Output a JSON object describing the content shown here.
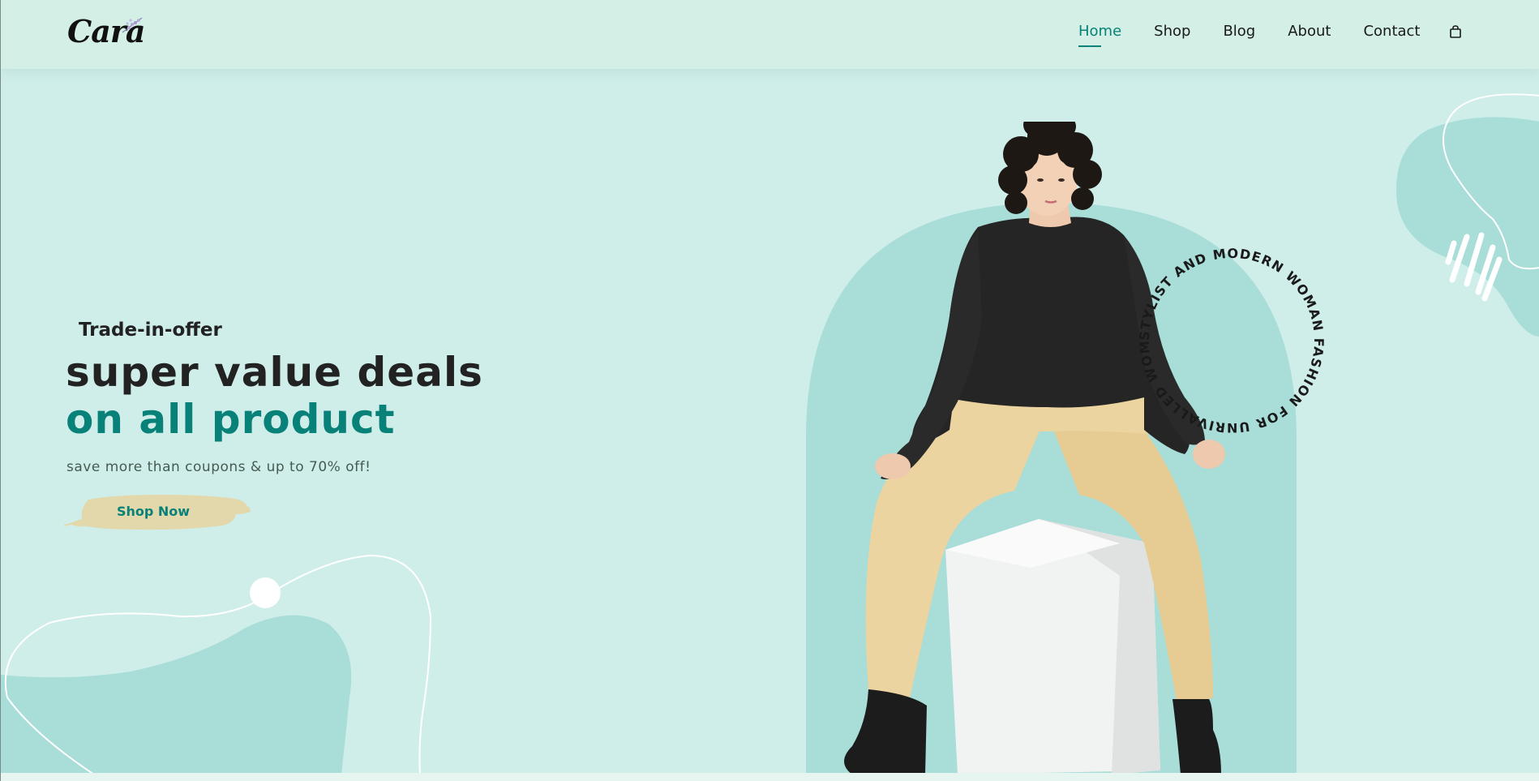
{
  "header": {
    "logo_text": "Cara",
    "nav": [
      {
        "label": "Home",
        "active": true
      },
      {
        "label": "Shop",
        "active": false
      },
      {
        "label": "Blog",
        "active": false
      },
      {
        "label": "About",
        "active": false
      },
      {
        "label": "Contact",
        "active": false
      }
    ],
    "cart_icon": "shopping-bag-icon"
  },
  "hero": {
    "eyebrow": "Trade-in-offer",
    "headline_line1": "super value deals",
    "headline_line2": "on all product",
    "subtitle": "save more than coupons & up to 70% off!",
    "cta_label": "Shop Now",
    "circular_text": "STYLIST AND MODERN WOMAN FASHION FOR UNRIVALLED WOMAN"
  },
  "colors": {
    "background": "#cfeeea",
    "header_bg": "#d3efe6",
    "accent": "#088178",
    "blob": "#a8ddd8",
    "button_brush": "#e3d8ab",
    "text_dark": "#222222"
  }
}
